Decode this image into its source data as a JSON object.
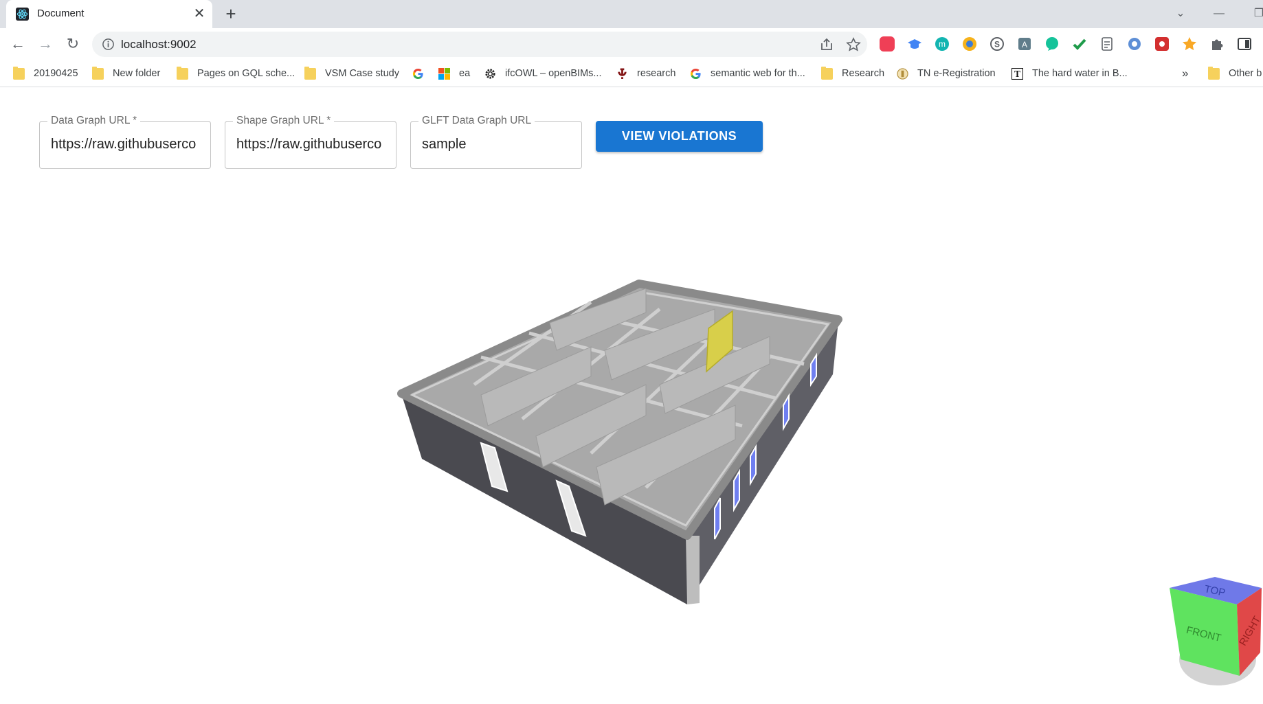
{
  "browser": {
    "tab": {
      "title": "Document",
      "close": "✕"
    },
    "newtab": "+",
    "window_controls": {
      "minimize": "—",
      "restore": "❐",
      "dropdown": "⌄"
    },
    "toolbar": {
      "back": "←",
      "forward": "→",
      "reload": "↻"
    },
    "address": {
      "url": "localhost:9002"
    },
    "bookmarks": [
      {
        "label": "20190425",
        "icon": "folder-icon"
      },
      {
        "label": "New folder",
        "icon": "folder-icon"
      },
      {
        "label": "Pages on GQL sche...",
        "icon": "folder-icon"
      },
      {
        "label": "VSM Case study",
        "icon": "folder-icon"
      },
      {
        "label": "",
        "icon": "google-icon"
      },
      {
        "label": "ea",
        "icon": "microsoft-icon"
      },
      {
        "label": "ifcOWL – openBIMs...",
        "icon": "gear-icon"
      },
      {
        "label": "research",
        "icon": "ou-icon"
      },
      {
        "label": "semantic web for th...",
        "icon": "google-icon"
      },
      {
        "label": "Research",
        "icon": "folder-icon"
      },
      {
        "label": "TN e-Registration",
        "icon": "emblem-icon"
      },
      {
        "label": "The hard water in B...",
        "icon": "nyt-icon"
      }
    ],
    "bookmarks_overflow": "»",
    "other_bookmarks": "Other b"
  },
  "app": {
    "fields": [
      {
        "label": "Data Graph URL *",
        "value": "https://raw.githubuserco"
      },
      {
        "label": "Shape Graph URL *",
        "value": "https://raw.githubuserco"
      },
      {
        "label": "GLFT Data Graph URL",
        "value": "sample"
      }
    ],
    "view_button": "VIEW VIOLATIONS",
    "viewcube": {
      "top": "TOP",
      "front": "FRONT",
      "right": "RIGHT"
    }
  },
  "colors": {
    "accent": "#1976d2",
    "wall_exterior": "#4a4a50",
    "wall_interior": "#b9b9b9",
    "highlight": "#d8cf4a"
  }
}
